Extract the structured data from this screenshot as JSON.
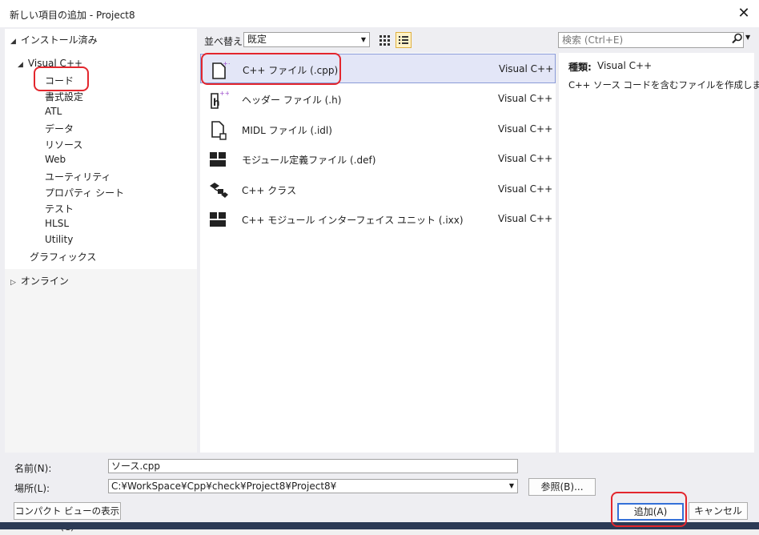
{
  "window": {
    "title": "新しい項目の追加 - Project8",
    "close_icon": "close-icon"
  },
  "tree": {
    "installed": "インストール済み",
    "visual_cpp": "Visual C++",
    "children": [
      "コード",
      "書式設定",
      "ATL",
      "データ",
      "リソース",
      "Web",
      "ユーティリティ",
      "プロパティ シート",
      "テスト",
      "HLSL",
      "Utility"
    ],
    "graphics": "グラフィックス",
    "online": "オンライン"
  },
  "sort": {
    "label": "並べ替え:",
    "value": "既定"
  },
  "search": {
    "placeholder": "検索 (Ctrl+E)"
  },
  "templates": [
    {
      "name": "C++ ファイル (.cpp)",
      "type": "Visual C++",
      "icon": "cpp-file-icon"
    },
    {
      "name": "ヘッダー ファイル (.h)",
      "type": "Visual C++",
      "icon": "header-file-icon"
    },
    {
      "name": "MIDL ファイル (.idl)",
      "type": "Visual C++",
      "icon": "midl-file-icon"
    },
    {
      "name": "モジュール定義ファイル (.def)",
      "type": "Visual C++",
      "icon": "module-def-icon"
    },
    {
      "name": "C++ クラス",
      "type": "Visual C++",
      "icon": "cpp-class-icon"
    },
    {
      "name": "C++ モジュール インターフェイス ユニット (.ixx)",
      "type": "Visual C++",
      "icon": "module-interface-icon"
    }
  ],
  "info": {
    "type_label": "種類:",
    "type_value": "Visual C++",
    "description": "C++ ソース コードを含むファイルを作成します"
  },
  "form": {
    "name_label": "名前(N):",
    "name_value": "ソース.cpp",
    "location_label": "場所(L):",
    "location_value": "C:¥WorkSpace¥Cpp¥check¥Project8¥Project8¥",
    "browse_label": "参照(B)...",
    "compact_label": "コンパクト ビューの表示(C)",
    "add_label": "追加(A)",
    "cancel_label": "キャンセル"
  },
  "colors": {
    "selection": "#e3e6f7",
    "annotation": "#e3262d",
    "primary_border": "#3470d8"
  }
}
